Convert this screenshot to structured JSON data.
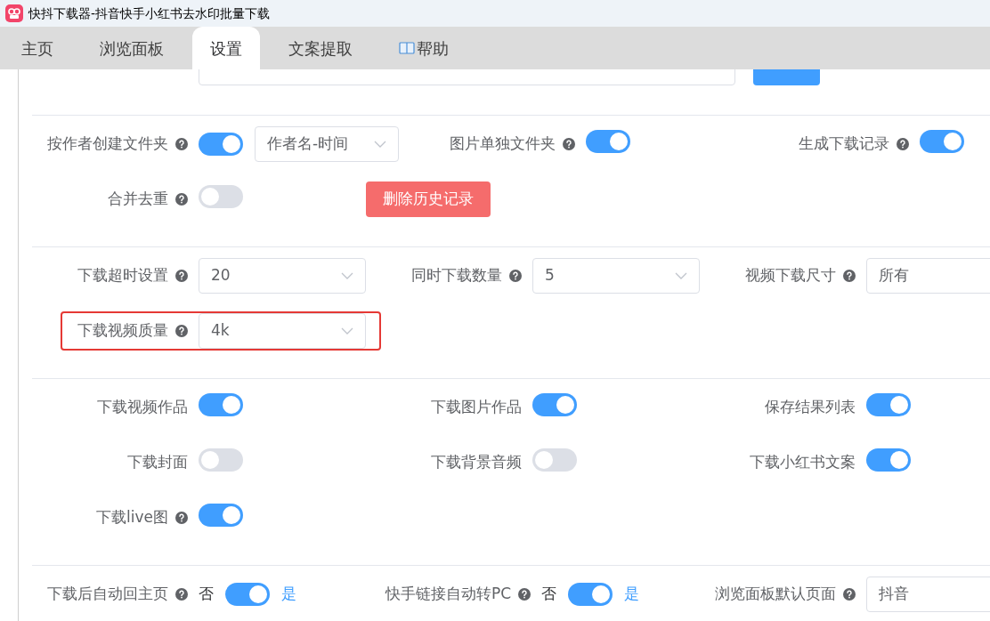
{
  "window": {
    "title": "快抖下载器-抖音快手小红书去水印批量下载"
  },
  "tabs": [
    {
      "label": "主页",
      "selected": false,
      "kind": "plain"
    },
    {
      "label": "浏览面板",
      "selected": false,
      "kind": "plain"
    },
    {
      "label": "设置",
      "selected": true,
      "kind": "plain"
    },
    {
      "label": "文案提取",
      "selected": false,
      "kind": "plain"
    },
    {
      "label": "帮助",
      "selected": false,
      "kind": "with-icon"
    }
  ],
  "scrolled_row": {
    "kind": "path"
  },
  "sections": [
    {
      "rows": [
        {
          "items": [
            {
              "kind": "toggle-select",
              "label": "按作者创建文件夹",
              "help": true,
              "on": true,
              "value": "作者名-时间"
            },
            {
              "kind": "toggle",
              "label": "图片单独文件夹",
              "help": true,
              "on": true
            },
            {
              "kind": "toggle",
              "label": "生成下载记录",
              "help": true,
              "on": true
            }
          ]
        },
        {
          "items": [
            {
              "kind": "toggle",
              "label": "合并去重",
              "help": true,
              "on": false
            },
            {
              "kind": "button",
              "label": "删除历史记录"
            }
          ]
        }
      ]
    },
    {
      "rows": [
        {
          "items": [
            {
              "kind": "select",
              "label": "下载超时设置",
              "help": true,
              "value": "20"
            },
            {
              "kind": "select",
              "label": "同时下载数量",
              "help": true,
              "value": "5"
            },
            {
              "kind": "select",
              "label": "视频下载尺寸",
              "help": true,
              "value": "所有"
            }
          ]
        },
        {
          "items": [
            {
              "kind": "select",
              "label": "下载视频质量",
              "help": true,
              "value": "4k",
              "highlighted": true
            }
          ]
        }
      ]
    },
    {
      "rows": [
        {
          "items": [
            {
              "kind": "toggle",
              "label": "下载视频作品",
              "help": false,
              "on": true
            },
            {
              "kind": "toggle",
              "label": "下载图片作品",
              "help": false,
              "on": true
            },
            {
              "kind": "toggle",
              "label": "保存结果列表",
              "help": false,
              "on": true
            }
          ]
        },
        {
          "items": [
            {
              "kind": "toggle",
              "label": "下载封面",
              "help": false,
              "on": false
            },
            {
              "kind": "toggle",
              "label": "下载背景音频",
              "help": false,
              "on": false
            },
            {
              "kind": "toggle",
              "label": "下载小红书文案",
              "help": false,
              "on": true
            }
          ]
        },
        {
          "items": [
            {
              "kind": "toggle",
              "label": "下载live图",
              "help": true,
              "on": true
            }
          ]
        }
      ]
    },
    {
      "rows": [
        {
          "items": [
            {
              "kind": "choice",
              "label": "下载后自动回主页",
              "help": true,
              "on": true,
              "off_text": "否",
              "on_text": "是"
            },
            {
              "kind": "choice",
              "label": "快手链接自动转PC",
              "help": true,
              "on": true,
              "off_text": "否",
              "on_text": "是"
            },
            {
              "kind": "select",
              "label": "浏览面板默认页面",
              "help": true,
              "value": "抖音"
            }
          ]
        }
      ]
    }
  ]
}
